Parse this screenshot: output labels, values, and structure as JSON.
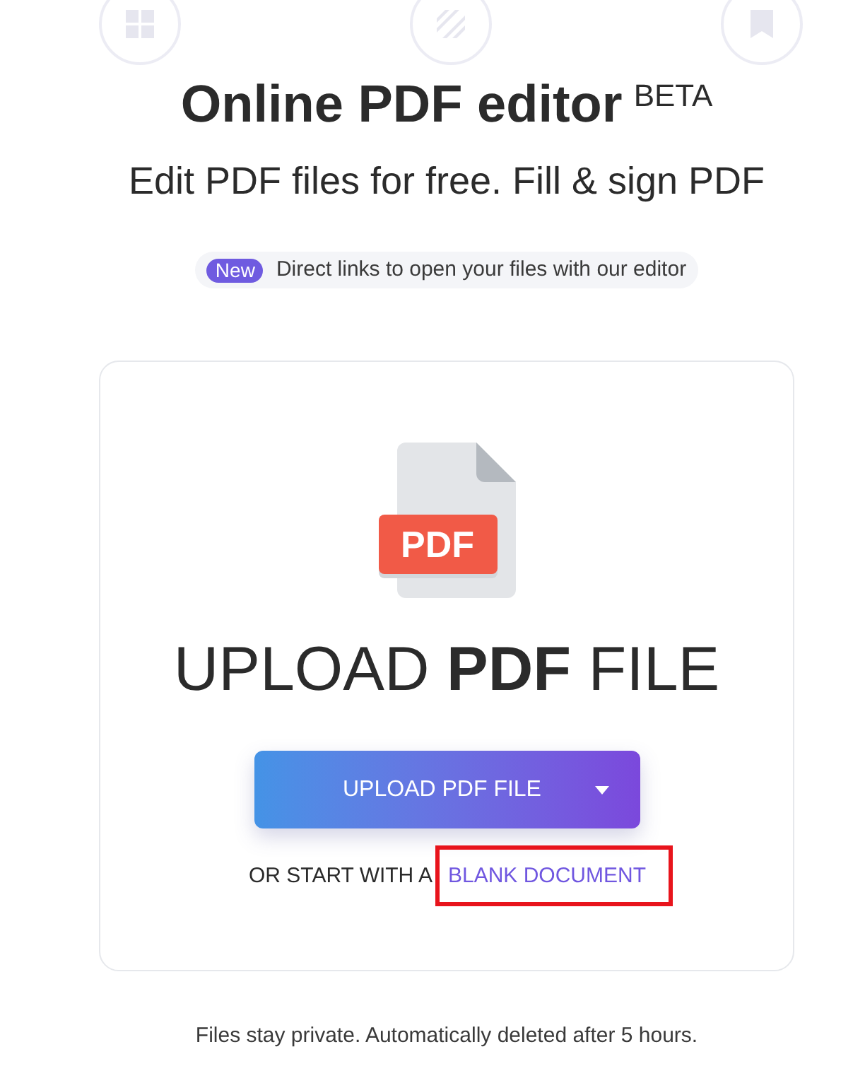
{
  "header": {
    "title": "Online PDF editor",
    "badge": "BETA",
    "subtitle": "Edit PDF files for free. Fill & sign PDF"
  },
  "announcement": {
    "tag": "New",
    "text": "Direct links to open your files with our editor"
  },
  "upload_card": {
    "file_badge": "PDF",
    "heading": "UPLOAD **PDF** FILE",
    "button": {
      "label": "UPLOAD PDF FILE"
    },
    "alternative": {
      "text": "OR START WITH A",
      "link": "BLANK DOCUMENT",
      "highlighted": true
    }
  },
  "footer": "Files stay private. Automatically deleted after 5 hours."
}
